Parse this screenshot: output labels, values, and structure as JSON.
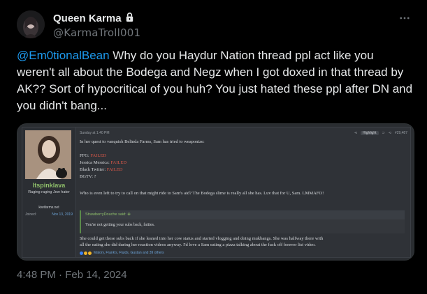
{
  "tweet": {
    "display_name": "Queen Karma",
    "handle": "@KarmaTroll001",
    "mention": "@Em0tionalBean",
    "text": " Why do you Haydur Nation thread ppl act like you weren't all about the Bodega and Negz when I got doxed in that thread by AK?? Sort of hypocritical of you huh? You just hated these ppl after DN and you didn't bang...",
    "timestamp": "4:48 PM · Feb 14, 2024",
    "icons": {
      "lock": "lock-icon",
      "more": "more-icon"
    }
  },
  "forum_post": {
    "username": "Itspinklava",
    "user_title": "Raging raging Jew hater",
    "site": "kiwifarms.net",
    "joined_label": "Joined:",
    "joined_date": "Nov 13, 2019",
    "post_time": "Sunday at 1:40 PM",
    "highlight_label": "Highlight",
    "post_number": "#29,487",
    "line_intro": "In her quest to vanquish Belinda Farms, Sam has tried to weaponize:",
    "items": [
      {
        "label": "FFG: ",
        "status": "FAILED"
      },
      {
        "label": "Jessica Messica: ",
        "status": "FAILED"
      },
      {
        "label": "Black Twitter: ",
        "status": "FAILED"
      },
      {
        "label": "BGTV: ?",
        "status": ""
      }
    ],
    "line_question": "Who is even left to try to call on that might ride to Sam's aid? The Bodega slime is really all she has. Luv that for U, Sam. LMMAFO!",
    "quote_author": "StrawberryDouche said: ⊕",
    "quote_text": "You're not getting your subs back, fatties.",
    "reply_line1": "She could get those subs back if she leaned into her cow status and started vlogging and doing mukbangs. She was halfway there with",
    "reply_line2": "all the eating she did during her reaction videos anyway. I'd love a Sam eating a pizza talking about the fuck off forever list video.",
    "reactions": "Malory, Frank's, Fluids, Gustan and 39 others"
  },
  "colors": {
    "link": "#1d9bf0",
    "muted": "#71767b",
    "failed": "#e05a4a",
    "username_green": "#8fbf6a"
  }
}
